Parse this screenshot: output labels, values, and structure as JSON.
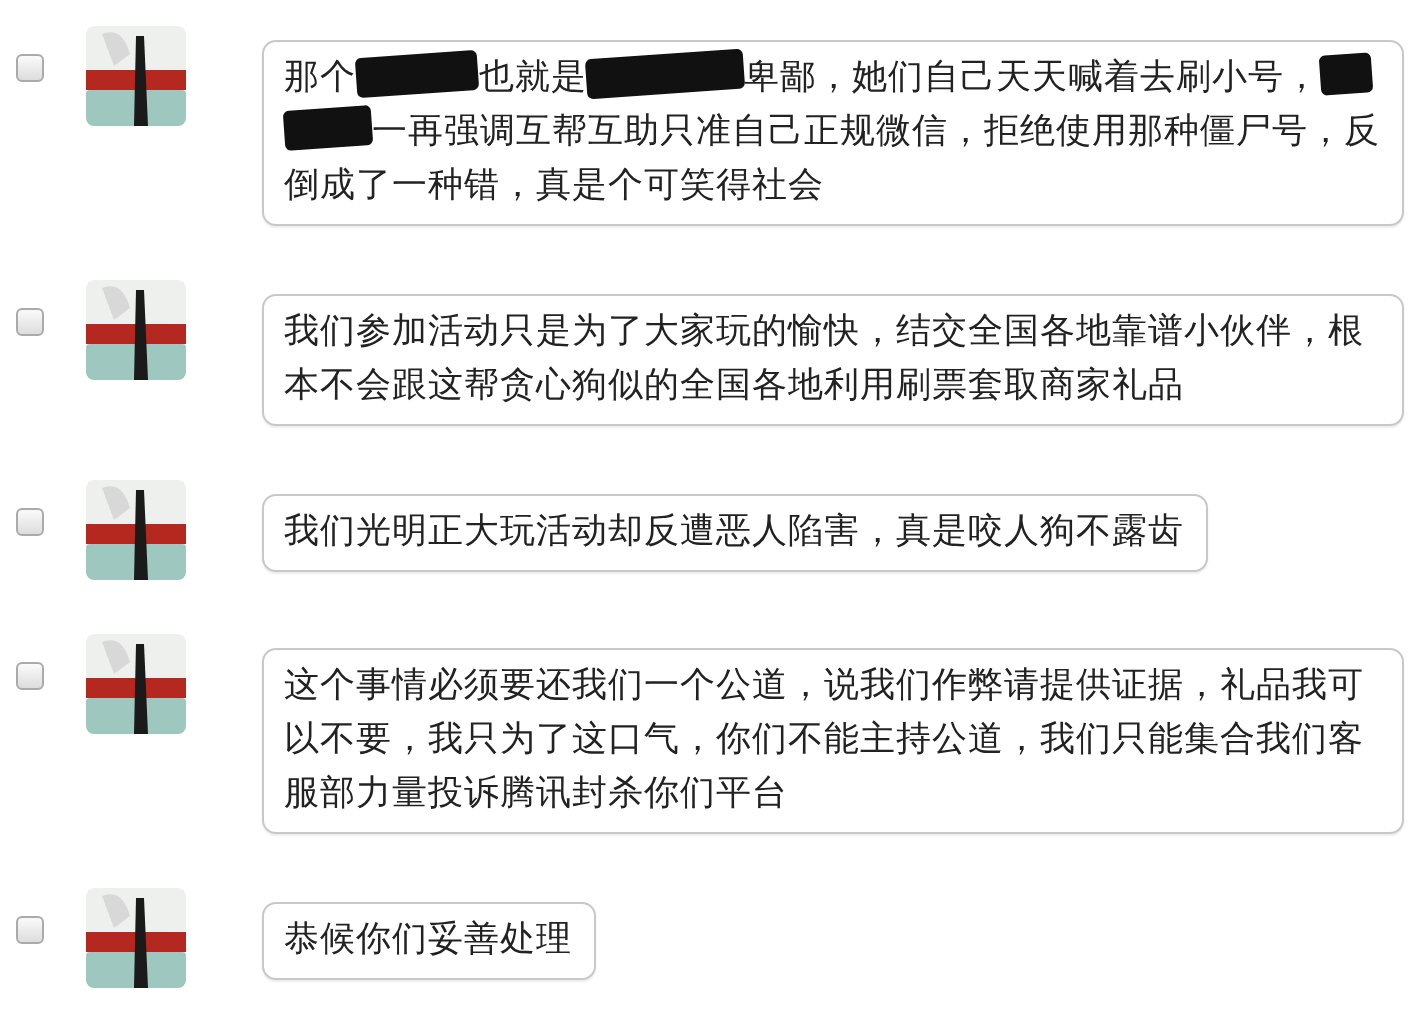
{
  "messages": [
    {
      "checked": false,
      "segments": [
        {
          "kind": "text",
          "text": "那个"
        },
        {
          "kind": "redacted"
        },
        {
          "kind": "text",
          "text": "也就是"
        },
        {
          "kind": "redacted"
        },
        {
          "kind": "text",
          "text": "卑鄙，她们自己天天喊着去刷小号，"
        },
        {
          "kind": "redacted"
        },
        {
          "kind": "redacted"
        },
        {
          "kind": "text",
          "text": "一再强调互帮互助只准自己正规微信，拒绝使用那种僵尸号，反"
        },
        {
          "kind": "text",
          "text": "倒成了一种错，真是个可笑得社会"
        }
      ]
    },
    {
      "checked": false,
      "segments": [
        {
          "kind": "text",
          "text": "我们参加活动只是为了大家玩的愉快，结交全国各地靠谱小伙伴，根本不会跟这帮贪心狗似的全国各地利用刷票套取商家礼品"
        }
      ]
    },
    {
      "checked": false,
      "segments": [
        {
          "kind": "text",
          "text": "我们光明正大玩活动却反遭恶人陷害，真是咬人狗不露齿"
        }
      ]
    },
    {
      "checked": false,
      "segments": [
        {
          "kind": "text",
          "text": "这个事情必须要还我们一个公道，说我们作弊请提供证据，礼品我可以不要，我只为了这口气，你们不能主持公道，我们只能集合我们客服部力量投诉腾讯封杀你们平台"
        }
      ]
    },
    {
      "checked": false,
      "segments": [
        {
          "kind": "text",
          "text": "恭候你们妥善处理"
        }
      ]
    }
  ]
}
